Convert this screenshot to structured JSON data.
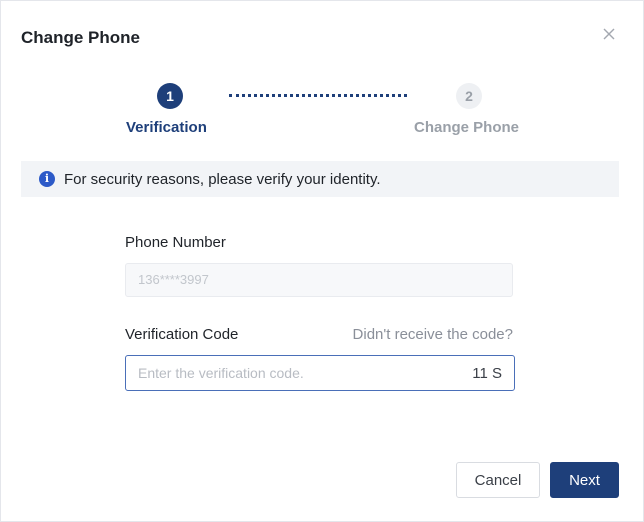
{
  "dialog": {
    "title": "Change Phone",
    "close_icon": "close-icon"
  },
  "steps": [
    {
      "number": "1",
      "label": "Verification",
      "state": "active"
    },
    {
      "number": "2",
      "label": "Change Phone",
      "state": "pending"
    }
  ],
  "banner": {
    "icon": "info-icon",
    "icon_glyph": "i",
    "text": "For security reasons, please verify your identity."
  },
  "form": {
    "phone_label": "Phone Number",
    "phone_value": "136****3997",
    "code_label": "Verification Code",
    "resend_link": "Didn't receive the code?",
    "code_placeholder": "Enter the verification code.",
    "code_value": "",
    "countdown": "11 S"
  },
  "actions": {
    "cancel_label": "Cancel",
    "next_label": "Next"
  },
  "colors": {
    "primary": "#1e3f7a",
    "info": "#2d5ac8",
    "muted": "#9aa0a8"
  }
}
